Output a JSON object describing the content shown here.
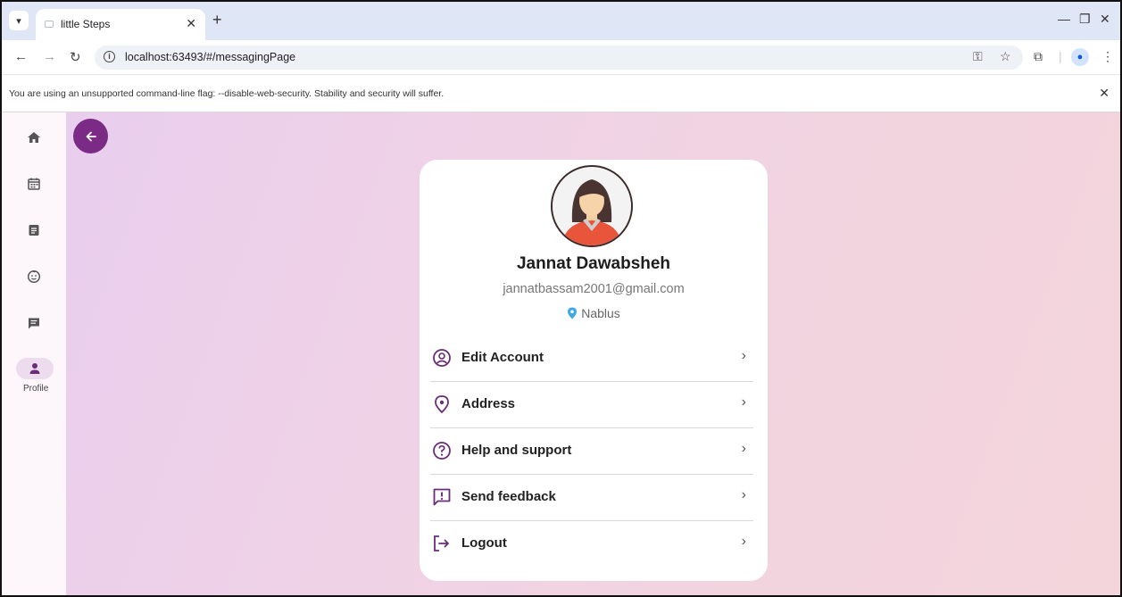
{
  "browser": {
    "tab_title": "little Steps",
    "url": "localhost:63493/#/messagingPage",
    "infobar_text": "You are using an unsupported command-line flag: --disable-web-security. Stability and security will suffer."
  },
  "rail": {
    "items": [
      {
        "icon": "home-icon"
      },
      {
        "icon": "calendar-icon"
      },
      {
        "icon": "notes-icon"
      },
      {
        "icon": "baby-face-icon"
      },
      {
        "icon": "chat-icon"
      },
      {
        "icon": "person-icon",
        "label": "Profile",
        "active": true
      }
    ]
  },
  "profile": {
    "name": "Jannat Dawabsheh",
    "email": "jannatbassam2001@gmail.com",
    "location": "Nablus"
  },
  "menu": [
    {
      "label": "Edit Account",
      "icon": "account-circle-icon"
    },
    {
      "label": "Address",
      "icon": "location-pin-icon"
    },
    {
      "label": "Help and support",
      "icon": "help-icon"
    },
    {
      "label": "Send feedback",
      "icon": "feedback-icon"
    },
    {
      "label": "Logout",
      "icon": "logout-icon"
    }
  ],
  "colors": {
    "accent": "#7b2a86",
    "pin": "#3fa9e8"
  }
}
